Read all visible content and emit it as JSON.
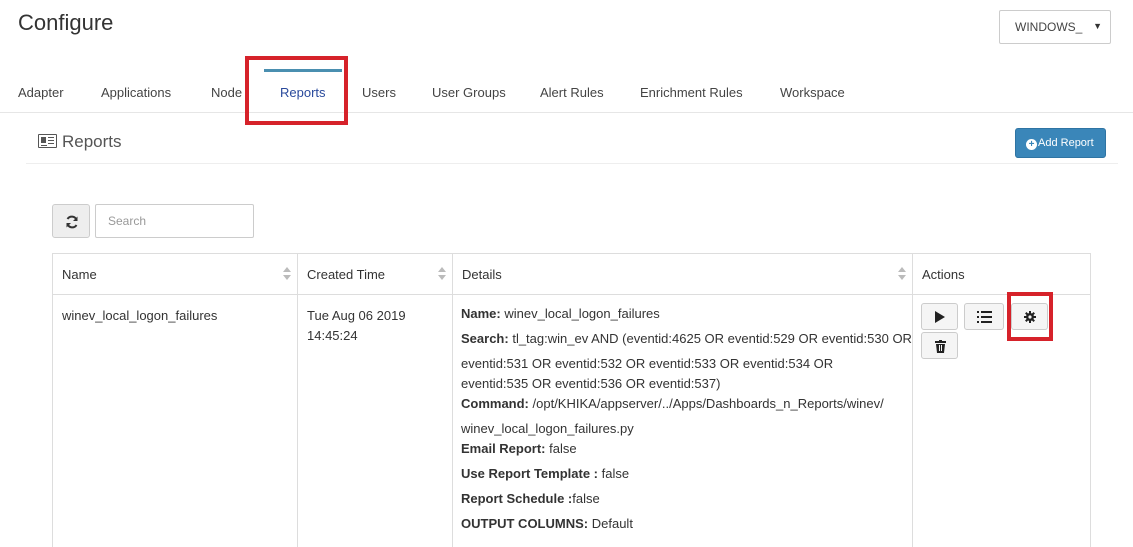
{
  "page": {
    "title": "Configure"
  },
  "selector": {
    "value": "WINDOWS_",
    "icon": "caret-down-icon"
  },
  "tabs": [
    {
      "label": "Adapter"
    },
    {
      "label": "Applications"
    },
    {
      "label": "Node"
    },
    {
      "label": "Reports",
      "active": true
    },
    {
      "label": "Users"
    },
    {
      "label": "User Groups"
    },
    {
      "label": "Alert Rules"
    },
    {
      "label": "Enrichment Rules"
    },
    {
      "label": "Workspace"
    }
  ],
  "section": {
    "title": "Reports",
    "icon": "newspaper-icon"
  },
  "toolbar": {
    "add_label": "Add Report",
    "search_placeholder": "Search",
    "refresh_icon": "refresh-icon"
  },
  "table": {
    "columns": [
      "Name",
      "Created Time",
      "Details",
      "Actions"
    ],
    "rows": [
      {
        "name": "winev_local_logon_failures",
        "created_date": "Tue Aug 06 2019",
        "created_time": "14:45:24",
        "details": {
          "name_label": "Name:",
          "name_value": "winev_local_logon_failures",
          "search_label": "Search:",
          "search_line1": "tl_tag:win_ev AND (eventid:4625 OR eventid:529 OR eventid:530 OR",
          "search_line2": "eventid:531 OR eventid:532 OR eventid:533 OR eventid:534 OR",
          "search_line3": "eventid:535 OR eventid:536 OR eventid:537)",
          "command_label": "Command:",
          "command_line1": "/opt/KHIKA/appserver/../Apps/Dashboards_n_Reports/winev/",
          "command_line2": "winev_local_logon_failures.py",
          "email_label": "Email Report:",
          "email_value": "false",
          "template_label": "Use Report Template :",
          "template_value": "false",
          "schedule_label": "Report Schedule :",
          "schedule_value": "false",
          "output_label": "OUTPUT COLUMNS:",
          "output_value": "Default"
        },
        "actions": [
          "play-icon",
          "list-icon",
          "gear-icon",
          "trash-icon"
        ]
      }
    ]
  },
  "colors": {
    "accent": "#3a86b9",
    "highlight": "#d6222a",
    "active_tab": "#2a4a9c"
  }
}
